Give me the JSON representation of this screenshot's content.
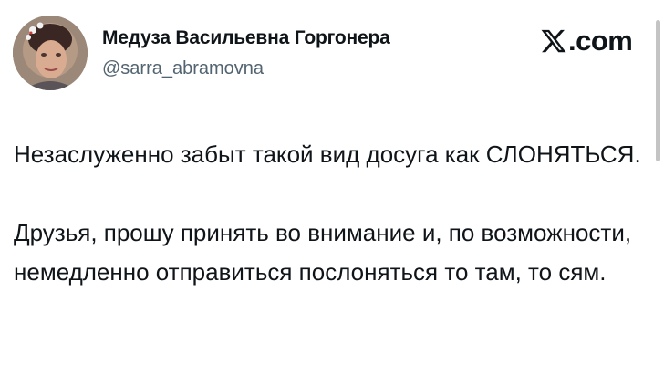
{
  "author": {
    "display_name": "Медуза Васильевна Горгонера",
    "handle": "@sarra_abramovna",
    "avatar_icon": "user-avatar-photo"
  },
  "brand": {
    "label": ".com",
    "icon": "x-logo-icon"
  },
  "tweet": {
    "paragraph_1": "Незаслуженно забыт такой вид досуга как СЛОНЯТЬСЯ.",
    "paragraph_2": "Друзья, прошу принять во внимание и, по возможности, немедленно отправиться послоняться то там, то сям."
  },
  "colors": {
    "text": "#0f1419",
    "secondary_text": "#536471",
    "background": "#ffffff"
  }
}
